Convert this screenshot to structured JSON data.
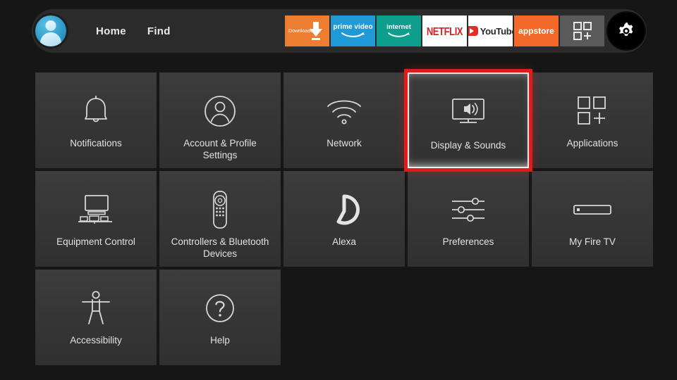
{
  "header": {
    "avatar": {
      "icon": "user-avatar-icon"
    },
    "nav": [
      {
        "label": "Home",
        "name": "nav-home"
      },
      {
        "label": "Find",
        "name": "nav-find"
      }
    ],
    "apps": [
      {
        "name": "app-downloader",
        "label": "Downloader",
        "icon": "download-arrow-icon",
        "color": "#ed7d31"
      },
      {
        "name": "app-prime-video",
        "label": "prime video",
        "icon": "amazon-smile-icon",
        "color": "#1f9ad6"
      },
      {
        "name": "app-internet",
        "label": "internet",
        "icon": "amazon-smile-icon",
        "color": "#0d9e8e"
      },
      {
        "name": "app-netflix",
        "label": "NETFLIX",
        "icon": "netflix-wordmark",
        "color": "#ffffff"
      },
      {
        "name": "app-youtube",
        "label": "YouTube",
        "icon": "youtube-play-icon",
        "color": "#ffffff"
      },
      {
        "name": "app-appstore",
        "label": "appstore",
        "icon": "appstore-wordmark",
        "color": "#f2692a"
      },
      {
        "name": "app-grid",
        "label": "",
        "icon": "grid-plus-icon",
        "color": "#5a5a5a"
      }
    ],
    "settings_button": {
      "name": "settings-gear-button",
      "icon": "gear-icon",
      "selected": true
    }
  },
  "settings": {
    "highlight_color": "#e01b1b",
    "tiles": [
      {
        "name": "tile-notifications",
        "label": "Notifications",
        "icon": "bell-icon",
        "selected": false
      },
      {
        "name": "tile-account-profile-settings",
        "label": "Account & Profile Settings",
        "icon": "person-circle-icon",
        "selected": false
      },
      {
        "name": "tile-network",
        "label": "Network",
        "icon": "wifi-icon",
        "selected": false
      },
      {
        "name": "tile-display-sounds",
        "label": "Display & Sounds",
        "icon": "tv-speaker-icon",
        "selected": true
      },
      {
        "name": "tile-applications",
        "label": "Applications",
        "icon": "grid-plus-icon",
        "selected": false
      },
      {
        "name": "tile-equipment-control",
        "label": "Equipment Control",
        "icon": "tv-equipment-icon",
        "selected": false
      },
      {
        "name": "tile-controllers-bluetooth-devices",
        "label": "Controllers & Bluetooth Devices",
        "icon": "remote-control-icon",
        "selected": false
      },
      {
        "name": "tile-alexa",
        "label": "Alexa",
        "icon": "alexa-ring-icon",
        "selected": false
      },
      {
        "name": "tile-preferences",
        "label": "Preferences",
        "icon": "sliders-icon",
        "selected": false
      },
      {
        "name": "tile-my-fire-tv",
        "label": "My Fire TV",
        "icon": "firetv-stick-icon",
        "selected": false
      },
      {
        "name": "tile-accessibility",
        "label": "Accessibility",
        "icon": "accessibility-person-icon",
        "selected": false
      },
      {
        "name": "tile-help",
        "label": "Help",
        "icon": "question-circle-icon",
        "selected": false
      }
    ]
  }
}
